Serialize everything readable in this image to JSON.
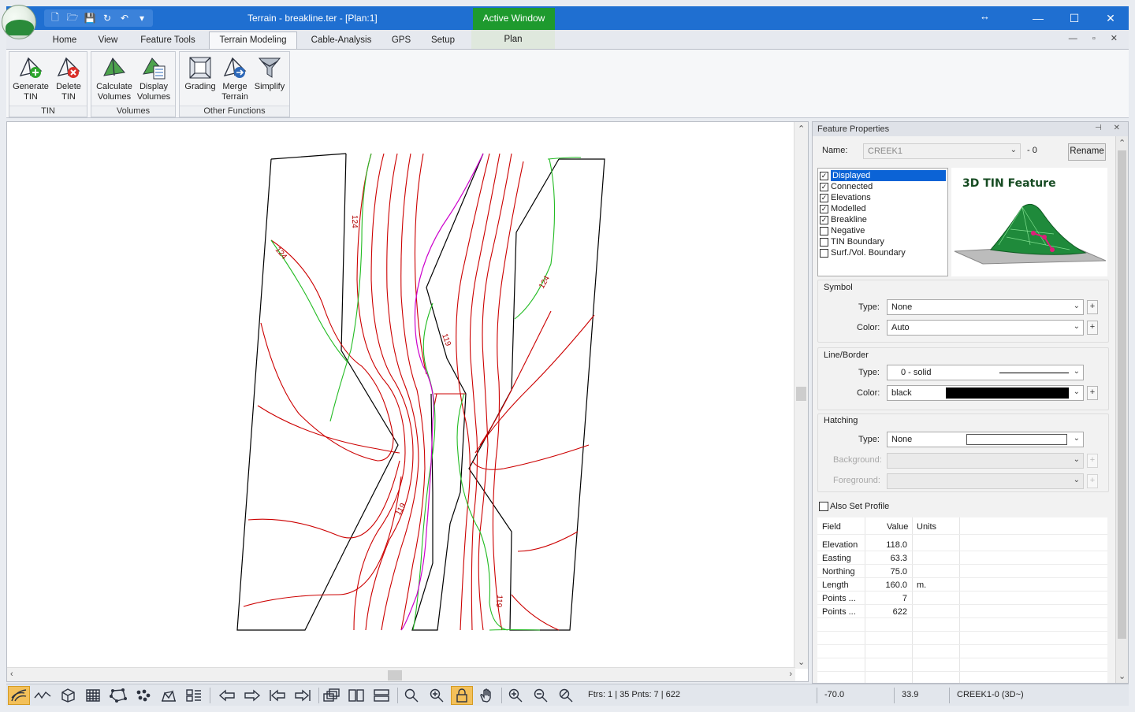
{
  "window": {
    "title": "Terrain - breakline.ter - [Plan:1]",
    "active_window_label": "Active Window",
    "controls": [
      "↔",
      "—",
      "☐",
      "✕"
    ]
  },
  "quick_access": [
    "new-document-icon",
    "open-folder-icon",
    "save-icon",
    "redo-icon",
    "undo-icon",
    "customize-icon"
  ],
  "tabs": [
    {
      "label": "Home"
    },
    {
      "label": "View"
    },
    {
      "label": "Feature Tools"
    },
    {
      "label": "Terrain Modeling",
      "active": true
    },
    {
      "label": "Cable-Analysis"
    },
    {
      "label": "GPS"
    },
    {
      "label": "Setup"
    }
  ],
  "plan_tab": "Plan",
  "ribbon": {
    "groups": [
      {
        "label": "TIN",
        "buttons": [
          {
            "line1": "Generate",
            "line2": "TIN"
          },
          {
            "line1": "Delete",
            "line2": "TIN"
          }
        ]
      },
      {
        "label": "Volumes",
        "buttons": [
          {
            "line1": "Calculate",
            "line2": "Volumes"
          },
          {
            "line1": "Display",
            "line2": "Volumes"
          }
        ]
      },
      {
        "label": "Other Functions",
        "buttons": [
          {
            "line1": "Grading",
            "line2": ""
          },
          {
            "line1": "Merge",
            "line2": "Terrain"
          },
          {
            "line1": "Simplify",
            "line2": ""
          }
        ]
      }
    ]
  },
  "plan": {
    "contour_labels": [
      "124",
      "124",
      "124",
      "119",
      "119",
      "119"
    ],
    "colors": {
      "contour": "#cc0000",
      "index_contour": "#22bb22",
      "breakline": "#cc00cc",
      "boundary": "#000000"
    }
  },
  "feature_panel": {
    "title": "Feature Properties",
    "name_label": "Name:",
    "name_value": "CREEK1",
    "name_suffix": "- 0",
    "rename_button": "Rename",
    "options": [
      {
        "label": "Displayed",
        "checked": true,
        "selected": true
      },
      {
        "label": "Connected",
        "checked": true
      },
      {
        "label": "Elevations",
        "checked": true
      },
      {
        "label": "Modelled",
        "checked": true
      },
      {
        "label": "Breakline",
        "checked": true
      },
      {
        "label": "Negative",
        "checked": false
      },
      {
        "label": "TIN Boundary",
        "checked": false
      },
      {
        "label": "Surf./Vol. Boundary",
        "checked": false
      }
    ],
    "tin_card_title": "3D TIN Feature",
    "symbol": {
      "heading": "Symbol",
      "type_label": "Type:",
      "type_value": "None",
      "color_label": "Color:",
      "color_value": "Auto"
    },
    "line_border": {
      "heading": "Line/Border",
      "type_label": "Type:",
      "type_value": "0 - solid",
      "color_label": "Color:",
      "color_value": "black"
    },
    "hatching": {
      "heading": "Hatching",
      "type_label": "Type:",
      "type_value": "None",
      "background_label": "Background:",
      "foreground_label": "Foreground:"
    },
    "also_set_profile": "Also Set Profile",
    "grid": {
      "headers": {
        "field": "Field",
        "value": "Value",
        "units": "Units"
      },
      "rows": [
        {
          "field": "Elevation",
          "value": "118.0",
          "units": ""
        },
        {
          "field": "Easting",
          "value": "63.3",
          "units": ""
        },
        {
          "field": "Northing",
          "value": "75.0",
          "units": ""
        },
        {
          "field": "Length",
          "value": "160.0",
          "units": "m."
        },
        {
          "field": "Points ...",
          "value": "7",
          "units": ""
        },
        {
          "field": "Points ...",
          "value": "622",
          "units": ""
        }
      ]
    }
  },
  "statusbar": {
    "features_text": "Ftrs: 1 | 35  Pnts: 7 | 622",
    "x": "-70.0",
    "y": "33.9",
    "feature": "CREEK1-0 (3D~)"
  }
}
